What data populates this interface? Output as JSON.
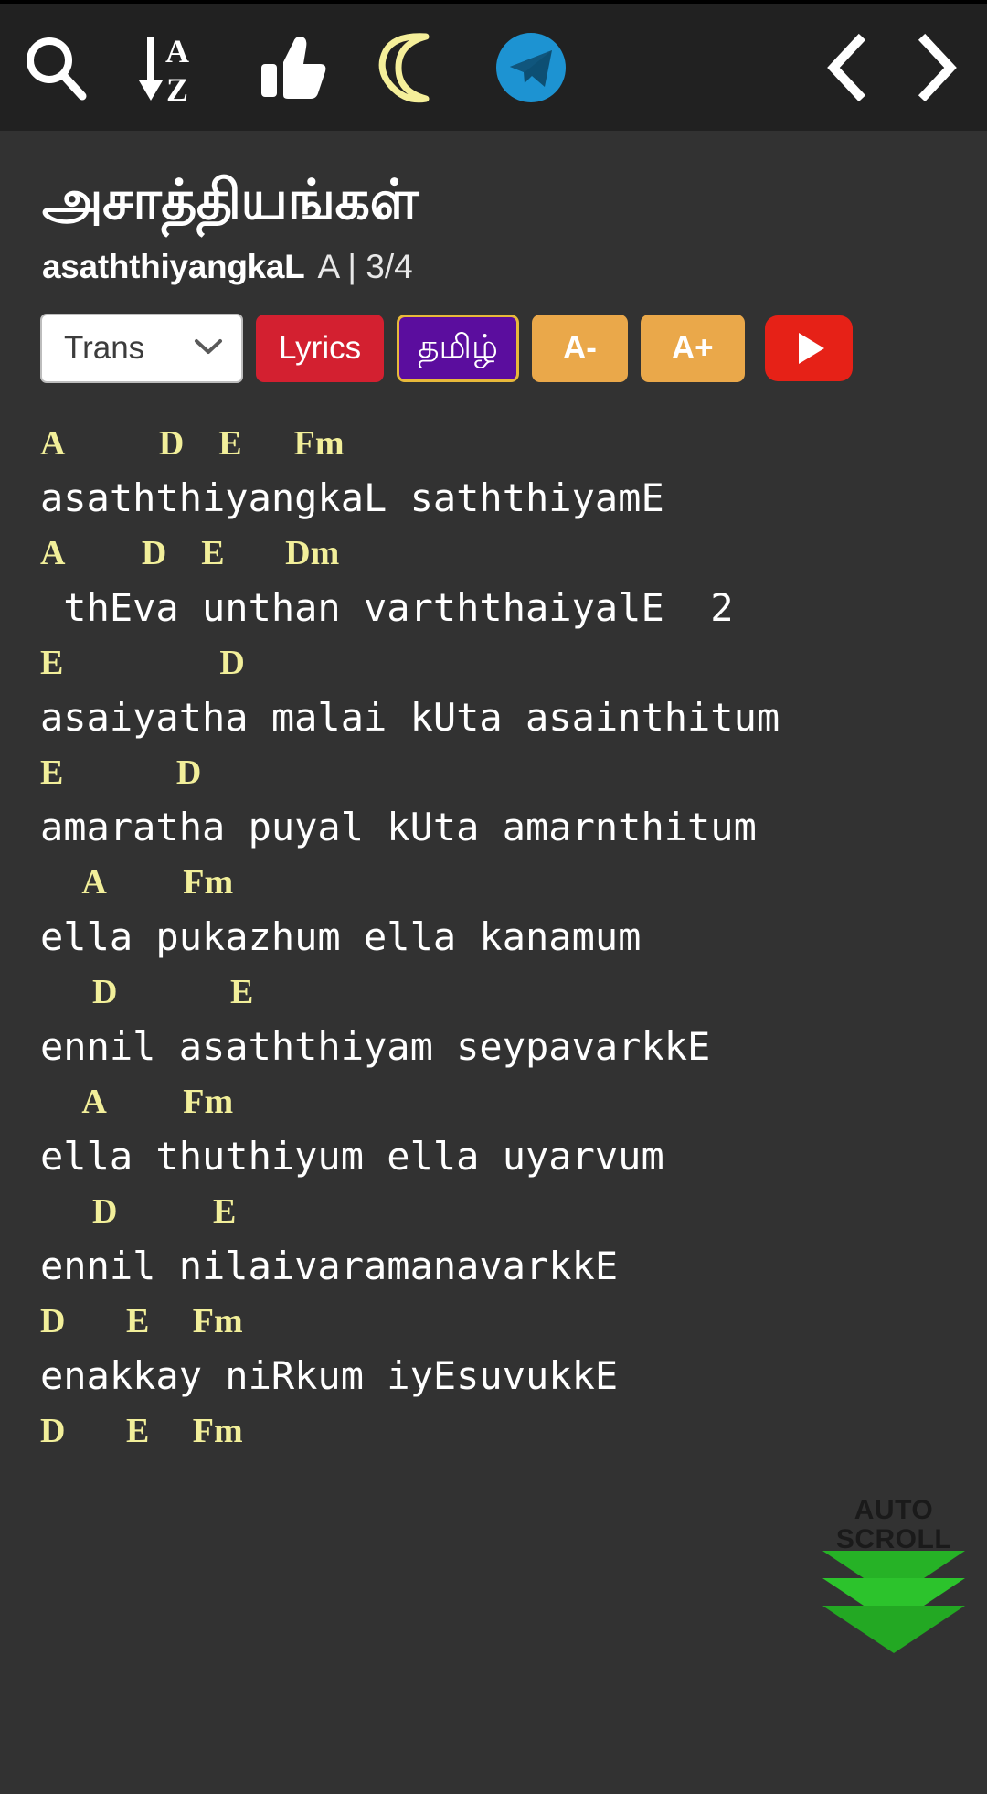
{
  "toolbar": {
    "icons": [
      {
        "name": "search-icon",
        "label": "Search"
      },
      {
        "name": "sort-alpha-icon",
        "label": "Sort A-Z"
      },
      {
        "name": "thumbs-up-icon",
        "label": "Like"
      },
      {
        "name": "moon-icon",
        "label": "Night mode"
      },
      {
        "name": "telegram-icon",
        "label": "Share to Telegram"
      }
    ],
    "prev_label": "‹",
    "next_label": "›"
  },
  "song": {
    "title_tamil": "அசாத்தியங்கள்",
    "title_translit": "asaththiyangkaL",
    "key_and_time": "A | 3/4"
  },
  "controls": {
    "trans_label": "Trans",
    "lyrics_label": "Lyrics",
    "tamil_label": "தமிழ்",
    "font_decrease_label": "A-",
    "font_increase_label": "A+",
    "youtube_label": "Play on YouTube"
  },
  "autoscroll": {
    "line1": "AUTO",
    "line2": "SCROLL"
  },
  "sheet": {
    "lines": [
      {
        "type": "chord",
        "text": "A           D    E      Fm"
      },
      {
        "type": "lyric",
        "text": "asaththiyangkaL saththiyamE"
      },
      {
        "type": "chord",
        "text": "A         D    E       Dm"
      },
      {
        "type": "lyric",
        "text": " thEva unthan varththaiyalE  2"
      },
      {
        "type": "chord",
        "text": "E                  D"
      },
      {
        "type": "lyric",
        "text": "asaiyatha malai kUta asainthitum"
      },
      {
        "type": "chord",
        "text": "E             D"
      },
      {
        "type": "lyric",
        "text": "amaratha puyal kUta amarnthitum"
      },
      {
        "type": "chord",
        "text": "     A         Fm"
      },
      {
        "type": "lyric",
        "text": "ella pukazhum ella kanamum"
      },
      {
        "type": "chord",
        "text": "      D             E"
      },
      {
        "type": "lyric",
        "text": "ennil asaththiyam seypavarkkE"
      },
      {
        "type": "chord",
        "text": "     A         Fm"
      },
      {
        "type": "lyric",
        "text": "ella thuthiyum ella uyarvum"
      },
      {
        "type": "chord",
        "text": "      D           E"
      },
      {
        "type": "lyric",
        "text": "ennil nilaivaramanavarkkE"
      },
      {
        "type": "chord",
        "text": "D       E     Fm"
      },
      {
        "type": "lyric",
        "text": "enakkay niRkum iyEsuvukkE"
      },
      {
        "type": "chord",
        "text": "D       E     Fm"
      }
    ]
  },
  "colors": {
    "background": "#323232",
    "toolbar_bg": "#212121",
    "chord": "#f2ef9a",
    "lyric": "#ffffff",
    "lyrics_btn": "#d32030",
    "tamil_btn": "#5b0d9e",
    "tamil_btn_border": "#e8b93a",
    "font_btn": "#eaa84a",
    "youtube_btn": "#e62117",
    "telegram": "#1d93d2",
    "moon": "#f5ef9a",
    "autoscroll_green": "#26b226"
  }
}
